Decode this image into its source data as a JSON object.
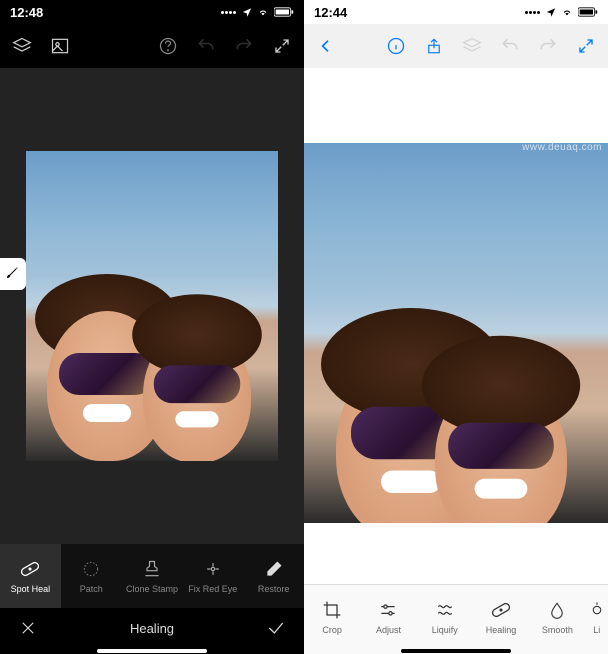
{
  "watermark": "www.deuaq.com",
  "left": {
    "status": {
      "time": "12:48",
      "location_icon": "location-arrow",
      "wifi_icon": "wifi",
      "battery_icon": "battery"
    },
    "appbar": {
      "layers_icon": "layers",
      "image_icon": "image",
      "help_icon": "help-circle",
      "undo_icon": "undo",
      "redo_icon": "redo",
      "expand_icon": "expand"
    },
    "floating_icon": "brush",
    "tools": [
      {
        "icon": "bandaid",
        "label": "Spot Heal",
        "active": true
      },
      {
        "icon": "patch",
        "label": "Patch",
        "active": false
      },
      {
        "icon": "stamp",
        "label": "Clone Stamp",
        "active": false
      },
      {
        "icon": "redeye",
        "label": "Fix Red Eye",
        "active": false
      },
      {
        "icon": "eraser",
        "label": "Restore",
        "active": false
      }
    ],
    "mode": {
      "cancel_icon": "x",
      "title": "Healing",
      "confirm_icon": "check"
    }
  },
  "right": {
    "status": {
      "time": "12:44",
      "location_icon": "location-arrow",
      "wifi_icon": "wifi",
      "battery_icon": "battery"
    },
    "appbar": {
      "back_icon": "chevron-left",
      "info_icon": "info-circle",
      "share_icon": "share",
      "layers_icon": "layers",
      "undo_icon": "undo",
      "redo_icon": "redo",
      "expand_icon": "expand"
    },
    "tools": [
      {
        "icon": "crop",
        "label": "Crop"
      },
      {
        "icon": "sliders",
        "label": "Adjust"
      },
      {
        "icon": "liquify",
        "label": "Liquify"
      },
      {
        "icon": "bandaid",
        "label": "Healing"
      },
      {
        "icon": "drop",
        "label": "Smooth"
      },
      {
        "icon": "light",
        "label": "Li"
      }
    ]
  }
}
